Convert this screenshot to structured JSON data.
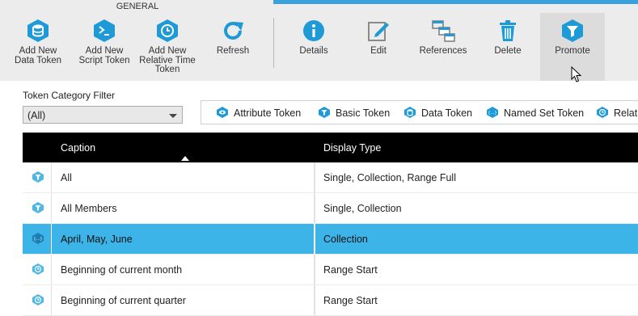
{
  "toolbar": {
    "group_label": "GENERAL",
    "buttons": [
      {
        "label": "Add New\nData Token",
        "icon": "data-token-icon"
      },
      {
        "label": "Add New\nScript Token",
        "icon": "script-token-icon"
      },
      {
        "label": "Add New\nRelative Time\nToken",
        "icon": "relative-time-token-icon"
      },
      {
        "label": "Refresh",
        "icon": "refresh-icon"
      },
      {
        "label": "Details",
        "icon": "info-icon"
      },
      {
        "label": "Edit",
        "icon": "edit-icon"
      },
      {
        "label": "References",
        "icon": "references-icon"
      },
      {
        "label": "Delete",
        "icon": "trash-icon"
      },
      {
        "label": "Promote",
        "icon": "filter-funnel-icon"
      }
    ]
  },
  "filter": {
    "label": "Token Category Filter",
    "value": "(All)"
  },
  "legend": {
    "items": [
      {
        "label": "Attribute Token",
        "icon": "attribute-token-icon"
      },
      {
        "label": "Basic Token",
        "icon": "basic-token-icon"
      },
      {
        "label": "Data Token",
        "icon": "data-token-icon"
      },
      {
        "label": "Named Set Token",
        "icon": "named-set-token-icon"
      },
      {
        "label": "Relative Time Token",
        "icon": "relative-time-token-icon"
      }
    ]
  },
  "grid": {
    "columns": [
      "Caption",
      "Display Type"
    ],
    "rows": [
      {
        "caption": "All",
        "display_type": "Single, Collection, Range Full",
        "icon": "basic-token-icon"
      },
      {
        "caption": "All Members",
        "display_type": "Single, Collection",
        "icon": "basic-token-icon"
      },
      {
        "caption": "April, May, June",
        "display_type": "Collection",
        "icon": "named-set-token-icon",
        "selected": true
      },
      {
        "caption": "Beginning of current month",
        "display_type": "Range Start",
        "icon": "relative-time-token-icon"
      },
      {
        "caption": "Beginning of current quarter",
        "display_type": "Range Start",
        "icon": "relative-time-token-icon"
      }
    ]
  },
  "colors": {
    "accent": "#3aa0dc",
    "selected_row": "#3cb4e7",
    "header_bg": "#000000",
    "icon_blue": "#1e9ad6"
  }
}
